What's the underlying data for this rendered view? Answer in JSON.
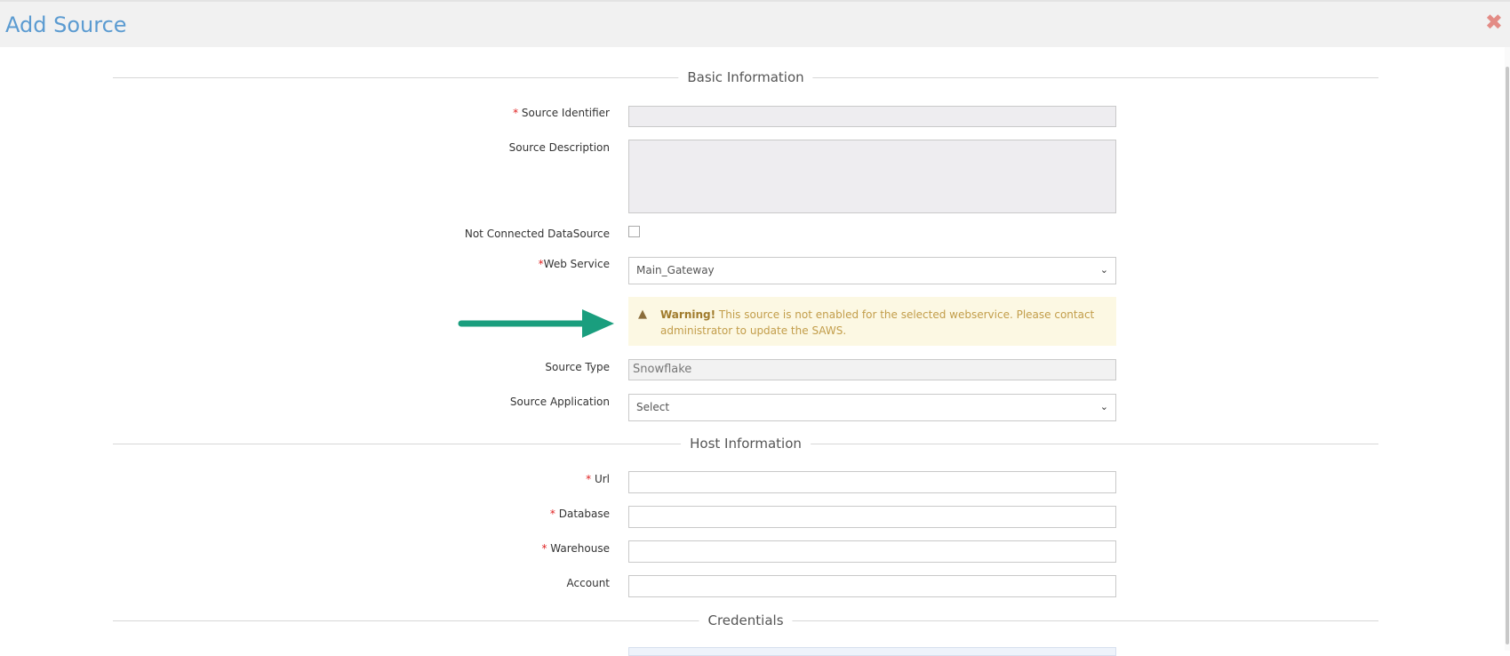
{
  "modal": {
    "title": "Add Source",
    "close_glyph": "✖"
  },
  "sections": {
    "basic": "Basic Information",
    "host": "Host Information",
    "credentials": "Credentials"
  },
  "basic_info": {
    "source_identifier": {
      "label": "Source Identifier",
      "required": true,
      "value": ""
    },
    "source_description": {
      "label": "Source Description",
      "value": ""
    },
    "not_connected": {
      "label": "Not Connected DataSource",
      "checked": false
    },
    "web_service": {
      "label": "Web Service",
      "required": true,
      "selected": "Main_Gateway"
    },
    "warning": {
      "strong": "Warning!",
      "text": " This source is not enabled for the selected webservice. Please contact administrator to update the SAWS.",
      "icon": "warning-triangle-icon"
    },
    "source_type": {
      "label": "Source Type",
      "value": "Snowflake"
    },
    "source_application": {
      "label": "Source Application",
      "selected": "Select"
    }
  },
  "host_info": {
    "url": {
      "label": "Url",
      "required": true,
      "value": ""
    },
    "database": {
      "label": "Database",
      "required": true,
      "value": ""
    },
    "warehouse": {
      "label": "Warehouse",
      "required": true,
      "value": ""
    },
    "account": {
      "label": "Account",
      "value": ""
    }
  },
  "colors": {
    "title": "#5b9bd1",
    "required": "#e02222",
    "warning_bg": "#fcf8e3",
    "arrow": "#1a9e7e"
  }
}
